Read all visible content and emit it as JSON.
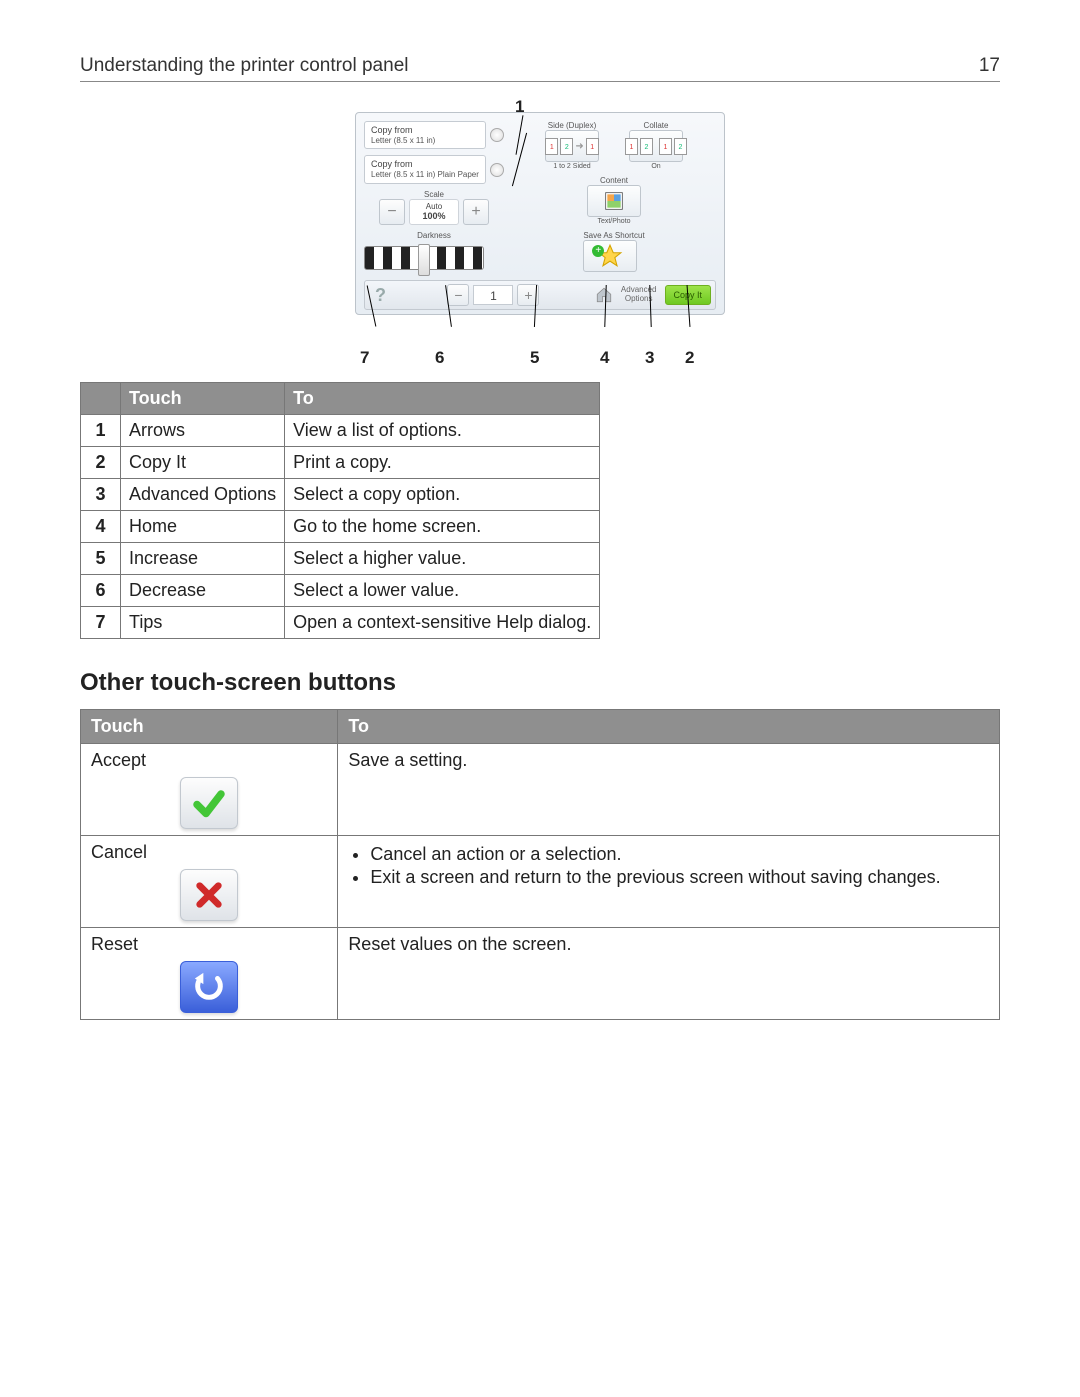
{
  "page_header": {
    "title": "Understanding the printer control panel",
    "page_number": "17"
  },
  "panel": {
    "copy_from_1": {
      "label": "Copy from",
      "value": "Letter (8.5 x 11 in)"
    },
    "copy_from_2": {
      "label": "Copy from",
      "value": "Letter (8.5 x 11 in) Plain Paper"
    },
    "scale": {
      "label": "Scale",
      "mode": "Auto",
      "value": "100%"
    },
    "darkness_label": "Darkness",
    "sides": {
      "group": "Side (Duplex)",
      "value": "1 to 2 Sided"
    },
    "collate": {
      "group": "Collate",
      "value": "On"
    },
    "content": {
      "group": "Content",
      "value": "Text/Photo"
    },
    "shortcut_label": "Save As Shortcut",
    "bottom": {
      "copies": "1",
      "advanced": "Advanced\nOptions",
      "copy_it": "Copy It"
    }
  },
  "callouts": {
    "c1": "1",
    "c2": "2",
    "c3": "3",
    "c4": "4",
    "c5": "5",
    "c6": "6",
    "c7": "7"
  },
  "touch_table": {
    "headers": {
      "h1": "",
      "h2": "Touch",
      "h3": "To"
    },
    "rows": [
      {
        "n": "1",
        "touch": "Arrows",
        "to": "View a list of options."
      },
      {
        "n": "2",
        "touch": "Copy It",
        "to": "Print a copy."
      },
      {
        "n": "3",
        "touch": "Advanced Options",
        "to": "Select a copy option."
      },
      {
        "n": "4",
        "touch": "Home",
        "to": "Go to the home screen."
      },
      {
        "n": "5",
        "touch": "Increase",
        "to": "Select a higher value."
      },
      {
        "n": "6",
        "touch": "Decrease",
        "to": "Select a lower value."
      },
      {
        "n": "7",
        "touch": "Tips",
        "to": "Open a context-sensitive Help dialog."
      }
    ]
  },
  "section_heading": "Other touch-screen buttons",
  "other_table": {
    "headers": {
      "h1": "Touch",
      "h2": "To"
    },
    "rows": {
      "accept": {
        "label": "Accept",
        "desc": "Save a setting."
      },
      "cancel": {
        "label": "Cancel",
        "b1": "Cancel an action or a selection.",
        "b2": "Exit a screen and return to the previous screen without saving changes."
      },
      "reset": {
        "label": "Reset",
        "desc": "Reset values on the screen."
      }
    }
  }
}
